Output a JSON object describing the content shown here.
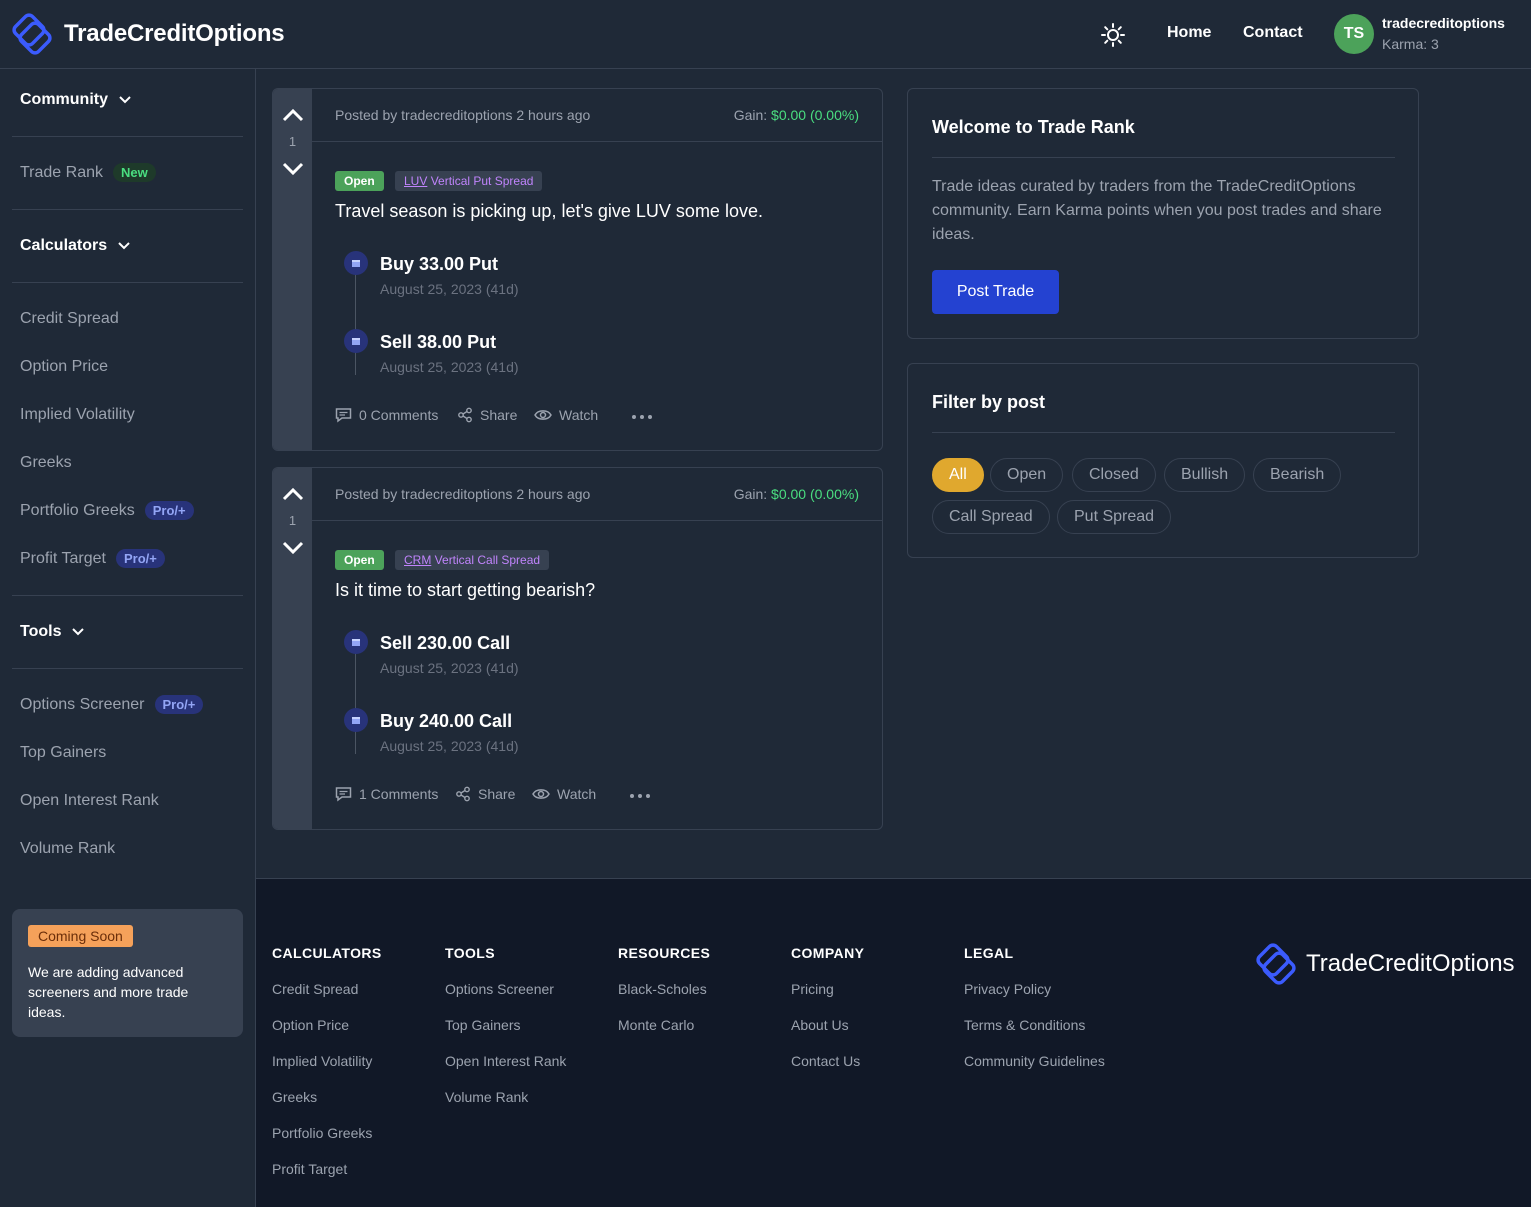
{
  "header": {
    "brand": "TradeCreditOptions",
    "nav": [
      "Home",
      "Contact"
    ],
    "user": {
      "initials": "TS",
      "name": "tradecreditoptions",
      "karma": "Karma: 3"
    }
  },
  "sidebar": {
    "community": "Community",
    "trade_rank": "Trade Rank",
    "new_badge": "New",
    "calculators": "Calculators",
    "calc_items": [
      "Credit Spread",
      "Option Price",
      "Implied Volatility",
      "Greeks",
      "Portfolio Greeks",
      "Profit Target"
    ],
    "tools": "Tools",
    "tool_items": [
      "Options Screener",
      "Top Gainers",
      "Open Interest Rank",
      "Volume Rank"
    ],
    "pro_badge": "Pro/+",
    "coming_soon": {
      "badge": "Coming Soon",
      "text": "We are adding advanced screeners and more trade ideas."
    }
  },
  "posts": [
    {
      "votes": "1",
      "posted_by": "Posted by tradecreditoptions 2 hours ago",
      "gain_label": "Gain:",
      "gain_value": "$0.00 (0.00%)",
      "status": "Open",
      "ticker": "LUV",
      "strategy": "Vertical Put Spread",
      "title": "Travel season is picking up, let's give LUV some love.",
      "legs": [
        {
          "title": "Buy 33.00 Put",
          "date": "August 25, 2023 (41d)"
        },
        {
          "title": "Sell 38.00 Put",
          "date": "August 25, 2023 (41d)"
        }
      ],
      "comments": "0 Comments",
      "share": "Share",
      "watch": "Watch"
    },
    {
      "votes": "1",
      "posted_by": "Posted by tradecreditoptions 2 hours ago",
      "gain_label": "Gain:",
      "gain_value": "$0.00 (0.00%)",
      "status": "Open",
      "ticker": "CRM",
      "strategy": "Vertical Call Spread",
      "title": "Is it time to start getting bearish?",
      "legs": [
        {
          "title": "Sell 230.00 Call",
          "date": "August 25, 2023 (41d)"
        },
        {
          "title": "Buy 240.00 Call",
          "date": "August 25, 2023 (41d)"
        }
      ],
      "comments": "1 Comments",
      "share": "Share",
      "watch": "Watch"
    }
  ],
  "welcome": {
    "title": "Welcome to Trade Rank",
    "text": "Trade ideas curated by traders from the TradeCreditOptions community. Earn Karma points when you post trades and share ideas.",
    "button": "Post Trade"
  },
  "filter": {
    "title": "Filter by post",
    "chips": [
      "All",
      "Open",
      "Closed",
      "Bullish",
      "Bearish",
      "Call Spread",
      "Put Spread"
    ],
    "selected": "All"
  },
  "footer": {
    "columns": [
      {
        "heading": "CALCULATORS",
        "links": [
          "Credit Spread",
          "Option Price",
          "Implied Volatility",
          "Greeks",
          "Portfolio Greeks",
          "Profit Target"
        ]
      },
      {
        "heading": "TOOLS",
        "links": [
          "Options Screener",
          "Top Gainers",
          "Open Interest Rank",
          "Volume Rank"
        ]
      },
      {
        "heading": "RESOURCES",
        "links": [
          "Black-Scholes",
          "Monte Carlo"
        ]
      },
      {
        "heading": "COMPANY",
        "links": [
          "Pricing",
          "About Us",
          "Contact Us"
        ]
      },
      {
        "heading": "LEGAL",
        "links": [
          "Privacy Policy",
          "Terms & Conditions",
          "Community Guidelines"
        ]
      }
    ],
    "brand": "TradeCreditOptions"
  },
  "colors": {
    "background": "#1f2937",
    "footer": "#111827",
    "accent_blue": "#2442d1",
    "gain_green": "#4ade80",
    "chip_active": "#e0a82e"
  }
}
